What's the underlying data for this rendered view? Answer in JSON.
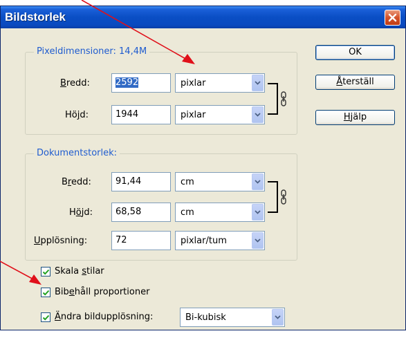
{
  "dialog": {
    "title": "Bildstorlek",
    "close_label": "✕"
  },
  "pixel_dims": {
    "legend": "Pixeldimensioner: 14,4M",
    "width_label_underlined": "B",
    "width_label_rest": "redd:",
    "width_value": "2592",
    "width_unit": "pixlar",
    "height_label_start": "Hö",
    "height_label_underlined": "j",
    "height_label_rest": "d:",
    "height_value": "1944",
    "height_unit": "pixlar"
  },
  "document_size": {
    "legend": "Dokumentstorlek:",
    "width_label_start": "B",
    "width_label_underlined": "r",
    "width_label_rest": "edd:",
    "width_value": "91,44",
    "width_unit": "cm",
    "height_label_start": "H",
    "height_label_underlined": "ö",
    "height_label_rest": "jd:",
    "height_value": "68,58",
    "height_unit": "cm",
    "resolution_label_underlined": "U",
    "resolution_label_rest": "pplösning:",
    "resolution_value": "72",
    "resolution_unit": "pixlar/tum"
  },
  "buttons": {
    "ok": "OK",
    "reset_underlined": "Å",
    "reset_rest": "terställ",
    "help_underlined": "H",
    "help_rest": "jälp"
  },
  "options": {
    "scale_styles_start": "Skala ",
    "scale_styles_underlined": "s",
    "scale_styles_rest": "tilar",
    "scale_styles_checked": true,
    "constrain_start": "Bib",
    "constrain_underlined": "e",
    "constrain_rest": "håll proportioner",
    "constrain_checked": true,
    "resample_underlined": "Ä",
    "resample_rest": "ndra bildupplösning:",
    "resample_checked": true,
    "resample_method": "Bi-kubisk"
  },
  "colors": {
    "titlebar": "#0a4ec4",
    "legend_text": "#1f5ccf",
    "dialog_bg": "#ece9d8",
    "annotation_arrow": "#e0101a"
  }
}
